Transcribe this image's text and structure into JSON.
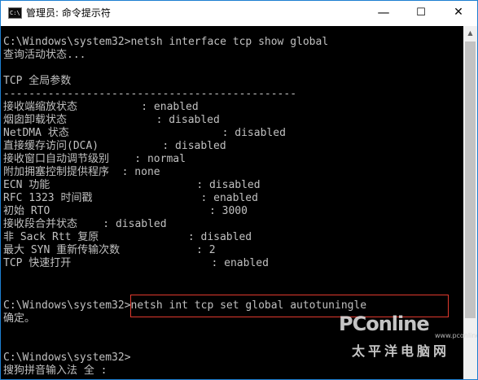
{
  "window": {
    "title": "管理员: 命令提示符",
    "icon": "cmd-icon",
    "minimize_glyph": "—",
    "maximize_glyph": "☐",
    "close_glyph": "✕"
  },
  "console": {
    "lines": [
      "C:\\Windows\\system32>netsh interface tcp show global",
      "查询活动状态...",
      "",
      "TCP 全局参数",
      "----------------------------------------------",
      "接收端缩放状态          : enabled",
      "烟囱卸载状态              : disabled",
      "NetDMA 状态                        : disabled",
      "直接缓存访问(DCA)          : disabled",
      "接收窗口自动调节级别    : normal",
      "附加拥塞控制提供程序  : none",
      "ECN 功能                       : disabled",
      "RFC 1323 时间戳                 : enabled",
      "初始 RTO                         : 3000",
      "接收段合并状态    : disabled",
      "非 Sack Rtt 复原              : disabled",
      "最大 SYN 重新传输次数            : 2",
      "TCP 快速打开                      : enabled",
      "",
      "",
      "C:\\Windows\\system32>netsh int tcp set global autotuningle",
      "确定。",
      "",
      "",
      "C:\\Windows\\system32>",
      "搜狗拼音输入法 全 :"
    ]
  },
  "watermark": {
    "brand": "PConline",
    "domain": "www.pconline.com.cn",
    "chinese": "太平洋电脑网"
  },
  "colors": {
    "console_bg": "#000000",
    "console_text": "#c0c0c0",
    "highlight_border": "#e03a2e",
    "window_border": "#1d7fd1"
  }
}
